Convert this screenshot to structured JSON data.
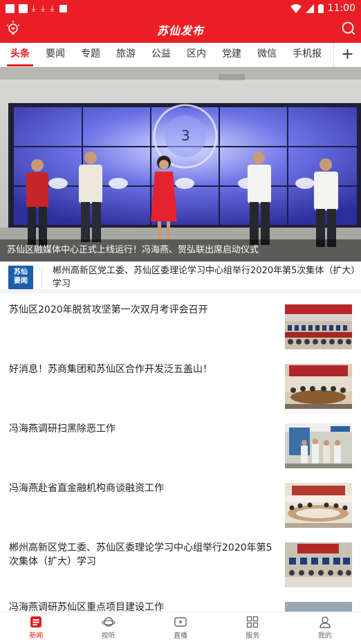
{
  "status": {
    "time": "11:00"
  },
  "app": {
    "title": "苏仙发布"
  },
  "tabs": [
    "头条",
    "要闻",
    "专题",
    "旅游",
    "公益",
    "区内",
    "党建",
    "微信",
    "手机报"
  ],
  "tab_add": "+",
  "banner": {
    "caption": "苏仙区融媒体中心正式上线运行！冯海燕、贺弘联出席启动仪式",
    "screen_number": "3"
  },
  "notice": {
    "logo_line1": "苏仙",
    "logo_line2": "要闻",
    "text": "郴州高新区党工委、苏仙区委理论学习中心组举行2020年第5次集体（扩大）学习"
  },
  "articles": [
    {
      "title": "苏仙区2020年脱贫攻坚第一次双月考评会召开"
    },
    {
      "title": "好消息！苏商集团和苏仙区合作开发泛五盖山！"
    },
    {
      "title": "冯海燕调研扫黑除恶工作"
    },
    {
      "title": "冯海燕赴省直金融机构商谈融资工作"
    },
    {
      "title": "郴州高新区党工委、苏仙区委理论学习中心组举行2020年第5次集体（扩大）学习"
    },
    {
      "title": "冯海燕调研苏仙区重点项目建设工作"
    }
  ],
  "bottom_nav": [
    {
      "label": "新闻",
      "icon": "news-icon"
    },
    {
      "label": "视听",
      "icon": "planet-icon"
    },
    {
      "label": "直播",
      "icon": "live-play-icon"
    },
    {
      "label": "服务",
      "icon": "grid-icon"
    },
    {
      "label": "我的",
      "icon": "user-icon"
    }
  ],
  "colors": {
    "brand_red": "#ea1f25",
    "active_red": "#e41c20",
    "notice_blue": "#1c5ea9"
  }
}
